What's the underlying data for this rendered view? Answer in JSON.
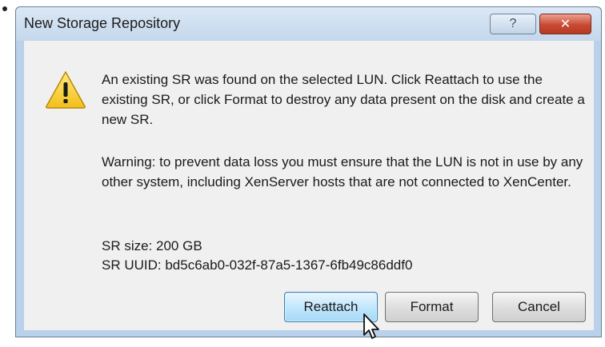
{
  "dialog": {
    "title": "New Storage Repository",
    "help_label": "?",
    "close_label": "✕"
  },
  "message": {
    "primary": "An existing SR was found on the selected LUN. Click Reattach to use the existing SR, or click Format to destroy any data present on the disk and create a new SR.",
    "warning": "Warning: to prevent data loss you must ensure that the LUN is not in use by any other system, including XenServer hosts that are not connected to XenCenter.",
    "sr_size": "SR size: 200 GB",
    "sr_uuid": "SR UUID: bd5c6ab0-032f-87a5-1367-6fb49c86ddf0"
  },
  "buttons": {
    "reattach": "Reattach",
    "format": "Format",
    "cancel": "Cancel"
  },
  "icons": {
    "dialog_icon": "warning-icon",
    "pointer": "mouse-cursor-icon"
  },
  "colors": {
    "title_bar": "#c4d7ec",
    "close_button": "#c94a33",
    "default_button_border": "#3c7fb1",
    "warning_fill": "#f7d335"
  }
}
